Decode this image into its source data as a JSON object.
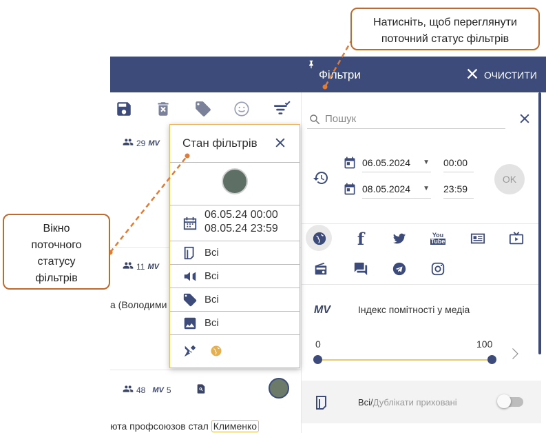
{
  "right_panel": {
    "title": "Фільтри",
    "clear_label": "ОЧИСТИТИ",
    "search_placeholder": "Пошук",
    "date_from": "06.05.2024",
    "time_from": "00:00",
    "date_to": "08.05.2024",
    "time_to": "23:59",
    "ok_label": "OK",
    "index_label": "Індекс помітності у медіа",
    "mv_label": "MV",
    "slider_min": "0",
    "slider_max": "100",
    "duplicates_all": "Всі/",
    "duplicates_hidden": "Дублікати приховані"
  },
  "popup": {
    "title": "Стан фільтрів",
    "date_line1": "06.05.24 00:00",
    "date_line2": "08.05.24 23:59",
    "row_all_1": "Всі",
    "row_all_2": "Всі",
    "row_all_3": "Всі",
    "row_all_4": "Всі"
  },
  "left_list": {
    "item1_count": "29",
    "item1_mv": "MV",
    "item2_count": "11",
    "item2_mv": "MV",
    "item2_text": "а (Володими",
    "item3_count": "48",
    "item3_mv": "MV",
    "item3_mv_value": "5",
    "item3_text": "юта профсоюзов стал",
    "item3_highlight": "Клименко"
  },
  "callouts": {
    "top": "Натисніть, щоб переглянути поточний статус фільтрів",
    "left": "Вікно поточного статусу фільтрів"
  },
  "colors": {
    "brand": "#3c4b7a",
    "accent": "#f0b35d",
    "callout_border": "#c0692a"
  }
}
